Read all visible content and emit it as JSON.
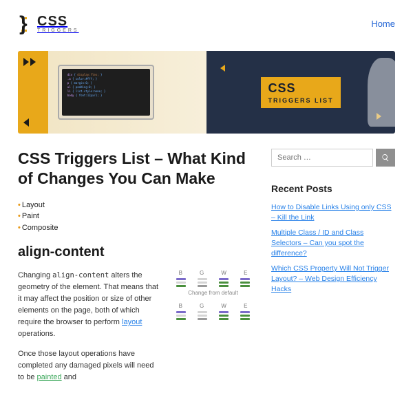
{
  "header": {
    "logo_big": "CSS",
    "logo_small": "TRIGGERS",
    "nav": {
      "home": "Home"
    }
  },
  "hero": {
    "badge_main": "CSS",
    "badge_sub": "TRIGGERS LIST"
  },
  "article": {
    "title": "CSS Triggers List – What Kind of Changes You Can Make",
    "bullets": [
      "Layout",
      "Paint",
      "Composite"
    ],
    "section_heading": "align-content",
    "para1_pre": "Changing ",
    "para1_code": "align-content",
    "para1_mid": " alters the geometry of the element. That means that it may affect the position or size of other elements on the page, both of which require the browser to perform ",
    "para1_link": "layout",
    "para1_post": " operations.",
    "para2_pre": "Once those layout operations have completed any damaged pixels will need to be ",
    "para2_link": "painted",
    "para2_post": " and",
    "engine_headers": [
      "B",
      "G",
      "W",
      "E"
    ],
    "engine_caption": "Change from default"
  },
  "sidebar": {
    "search_placeholder": "Search …",
    "recent_heading": "Recent Posts",
    "recent": [
      "How to Disable Links Using only CSS – Kill the Link",
      "Multiple Class / ID and Class Selectors – Can you spot the difference?",
      "Which CSS Property Will Not Trigger Layout? – Web Design Efficiency Hacks"
    ]
  }
}
